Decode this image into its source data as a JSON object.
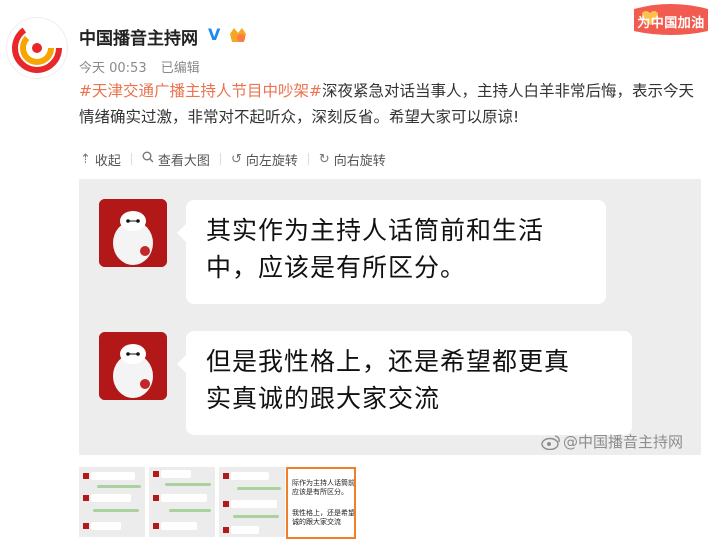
{
  "header": {
    "username": "中国播音主持网",
    "verified_mark": "V",
    "time": "今天 00:53",
    "edited": "已编辑",
    "banner": "为中国加油"
  },
  "post": {
    "hashtag": "#天津交通广播主持人节目中吵架#",
    "text": "深夜紧急对话当事人，主持人白羊非常后悔，表示今天情绪确实过激，非常对不起听众，深刻反省。希望大家可以原谅!"
  },
  "toolbar": {
    "collapse": "收起",
    "view_large": "查看大图",
    "rotate_left": "向左旋转",
    "rotate_right": "向右旋转"
  },
  "image": {
    "bubble1_line1": "其实作为主持人话筒前和生活",
    "bubble1_line2": "中，应该是有所区分。",
    "bubble2_line1": "但是我性格上，还是希望都更真",
    "bubble2_line2": "实真诚的跟大家交流",
    "watermark": "@中国播音主持网"
  },
  "thumbnails": {
    "active_line1": "际作为主持人话筒前和",
    "active_line2": "应该是有所区分。",
    "active_line3": "我性格上，还是希望",
    "active_line4": "诚的跟大家交流"
  },
  "colors": {
    "hashtag": "#eb7350",
    "verified": "#1d8cf0",
    "thumb_active_border": "#f07e2b"
  }
}
